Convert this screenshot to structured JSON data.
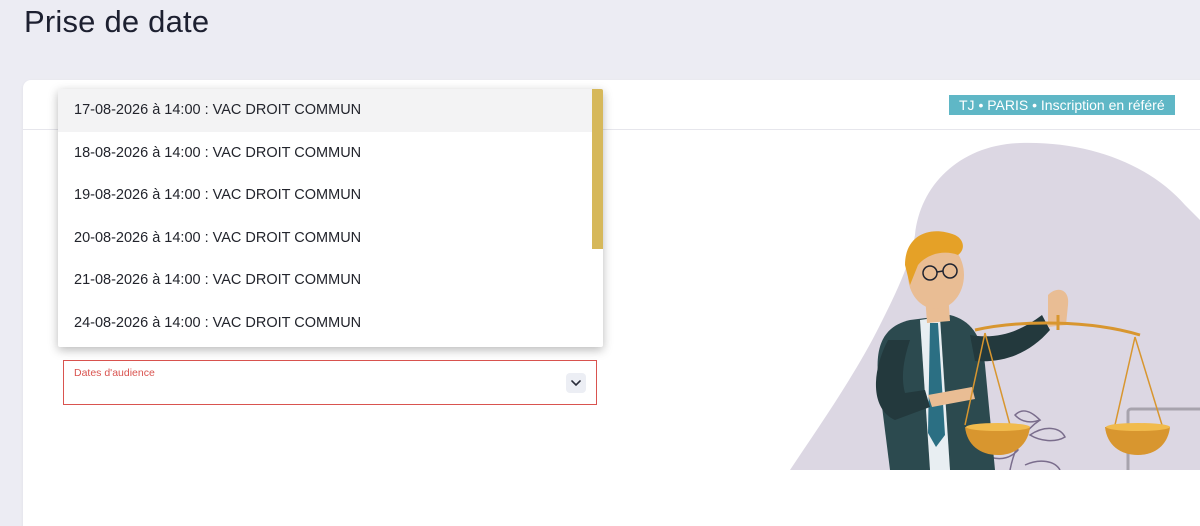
{
  "page": {
    "title": "Prise de date"
  },
  "header": {
    "context_badge": "TJ • PARIS • Inscription en référé"
  },
  "dropdown": {
    "options": [
      "17-08-2026 à 14:00 : VAC DROIT COMMUN",
      "18-08-2026 à 14:00 : VAC DROIT COMMUN",
      "19-08-2026 à 14:00 : VAC DROIT COMMUN",
      "20-08-2026 à 14:00 : VAC DROIT COMMUN",
      "21-08-2026 à 14:00 : VAC DROIT COMMUN",
      "24-08-2026 à 14:00 : VAC DROIT COMMUN"
    ],
    "highlighted_index": 0
  },
  "select": {
    "label": "Dates d'audience",
    "value": "",
    "icon": "chevron-down-icon"
  },
  "colors": {
    "background": "#ececf3",
    "badge": "#5fb7c6",
    "error": "#d9534f",
    "scrollbar": "#d6b85a"
  },
  "illustration": {
    "subject": "lawyer-with-scales-illustration"
  }
}
